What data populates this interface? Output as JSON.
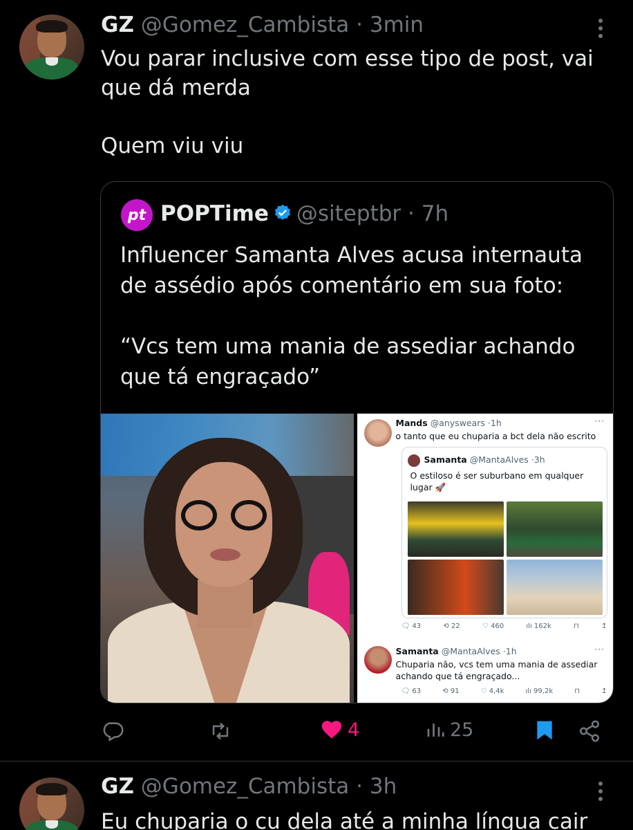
{
  "tweet1": {
    "name": "GZ",
    "handle": "@Gomez_Cambista",
    "separator": "·",
    "time": "3min",
    "text": "Vou parar inclusive com esse tipo de post, vai\nque dá merda\n\nQuem viu viu",
    "quote": {
      "logo_text": "pt",
      "name": "POPTime",
      "handle": "@siteptbr",
      "separator": "·",
      "time": "7h",
      "text": "Influencer Samanta Alves acusa internauta\nde assédio após comentário em sua foto:\n\n“Vcs tem uma mania de assediar achando\nque tá engraçado”",
      "screenshot": {
        "reply1": {
          "name": "Mands",
          "handle": "@anyswears",
          "separator": "·",
          "time": "1h",
          "text": "o tanto que eu chuparia a bct dela não escrito"
        },
        "quoted": {
          "name": "Samanta",
          "handle": "@MantaAlves",
          "separator": "·",
          "time": "3h",
          "text": "O estiloso é ser suburbano em qualquer lugar 🚀"
        },
        "reply1_stats": {
          "replies": "43",
          "retweets": "22",
          "likes": "460",
          "views": "162k"
        },
        "reply2": {
          "name": "Samanta",
          "handle": "@MantaAlves",
          "separator": "·",
          "time": "1h",
          "text": "Chuparia não, vcs tem uma mania de assediar achando que tá engraçado..."
        },
        "reply2_stats": {
          "replies": "63",
          "retweets": "91",
          "likes": "4,4k",
          "views": "99,2k"
        }
      }
    },
    "actions": {
      "likes": "4",
      "views": "25",
      "like_color": "#f91880",
      "bookmark_color": "#1d9bf0"
    }
  },
  "tweet2": {
    "name": "GZ",
    "handle": "@Gomez_Cambista",
    "separator": "·",
    "time": "3h",
    "text": "Eu chuparia o cu dela até a minha língua cair"
  },
  "theme": {
    "background": "#000000",
    "text": "#e7e9ea",
    "muted": "#71767b",
    "accent": "#1d9bf0",
    "logo": "#c316c9"
  },
  "icons": [
    "reply-icon",
    "retweet-icon",
    "like-icon",
    "views-icon",
    "bookmark-icon",
    "share-icon",
    "more-icon",
    "verified-icon"
  ]
}
